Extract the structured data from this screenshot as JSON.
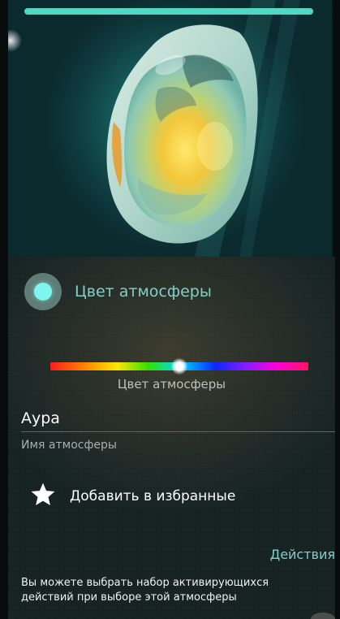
{
  "hero": {
    "image": "crystal-gem-image"
  },
  "atmosphere_color": {
    "toggle_label": "Цвет атмосферы",
    "spectrum_caption": "Цвет атмосферы",
    "selected_fraction": 0.5
  },
  "atmosphere_name": {
    "value": "Аура",
    "caption": "Имя атмосферы"
  },
  "favorite": {
    "icon": "star-icon",
    "label": "Добавить в избранные"
  },
  "actions": {
    "link": "Действия",
    "description": "Вы можете выбрать набор активирующихся действий при выборе этой атмосферы"
  },
  "colors": {
    "accent": "#7fd1c8",
    "radio_fill": "#7ff5f0"
  }
}
